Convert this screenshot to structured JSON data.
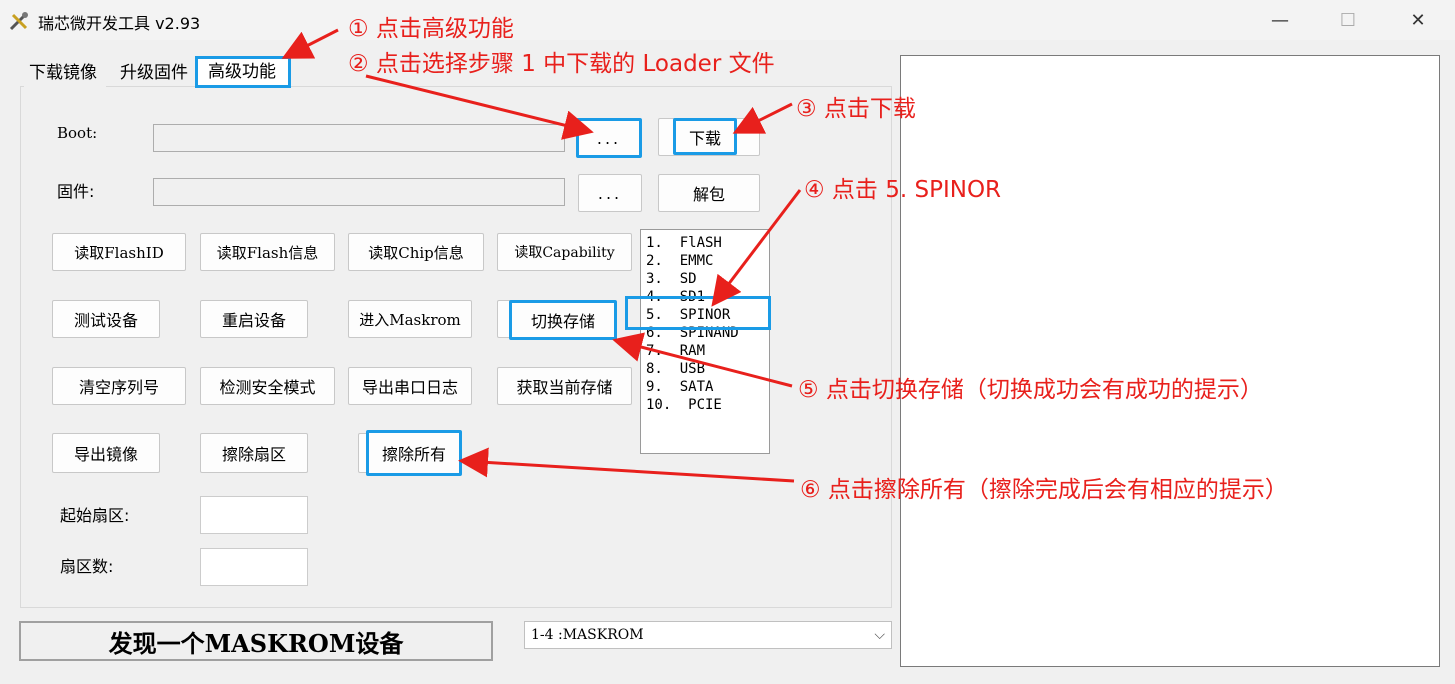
{
  "window": {
    "title": "瑞芯微开发工具 v2.93",
    "minimize": "—",
    "maximize": "☐",
    "close": "✕"
  },
  "tabs": [
    {
      "label": "下载镜像"
    },
    {
      "label": "升级固件"
    },
    {
      "label": "高级功能",
      "selected": true
    }
  ],
  "boot": {
    "label": "Boot:",
    "value": "",
    "browse_label": "...",
    "download_label": "下载"
  },
  "firmware": {
    "label": "固件:",
    "value": "",
    "browse_label": "...",
    "unpack_label": "解包"
  },
  "buttons": {
    "read_flash_id": "读取FlashID",
    "read_flash_info": "读取Flash信息",
    "read_chip_info": "读取Chip信息",
    "read_capability": "读取Capability",
    "test_device": "测试设备",
    "reboot_device": "重启设备",
    "enter_maskrom": "进入Maskrom",
    "switch_storage": "切换存储",
    "clear_serial": "清空序列号",
    "detect_safe_mode": "检测安全模式",
    "export_serial_log": "导出串口日志",
    "get_current_storage": "获取当前存储",
    "export_image": "导出镜像",
    "erase_sector": "擦除扇区",
    "erase_all": "擦除所有"
  },
  "storage_list": [
    "1.  FlASH",
    "2.  EMMC",
    "3.  SD",
    "4.  SD1",
    "5.  SPINOR",
    "6.  SPINAND",
    "7.  RAM",
    "8.  USB",
    "9.  SATA",
    "10.  PCIE"
  ],
  "sector": {
    "start_label": "起始扇区:",
    "start_value": "",
    "count_label": "扇区数:",
    "count_value": ""
  },
  "status": {
    "message": "发现一个MASKROM设备"
  },
  "device_select": {
    "value": "1-4  :MASKROM"
  },
  "annotations": {
    "a1": "① 点击高级功能",
    "a2": "② 点击选择步骤 1 中下载的 Loader 文件",
    "a3": "③ 点击下载",
    "a4": "④ 点击 5. SPINOR",
    "a5": "⑤ 点击切换存储（切换成功会有成功的提示）",
    "a6": "⑥ 点击擦除所有（擦除完成后会有相应的提示）"
  },
  "colors": {
    "annotation": "#e8201c",
    "highlight": "#1a9be6"
  }
}
